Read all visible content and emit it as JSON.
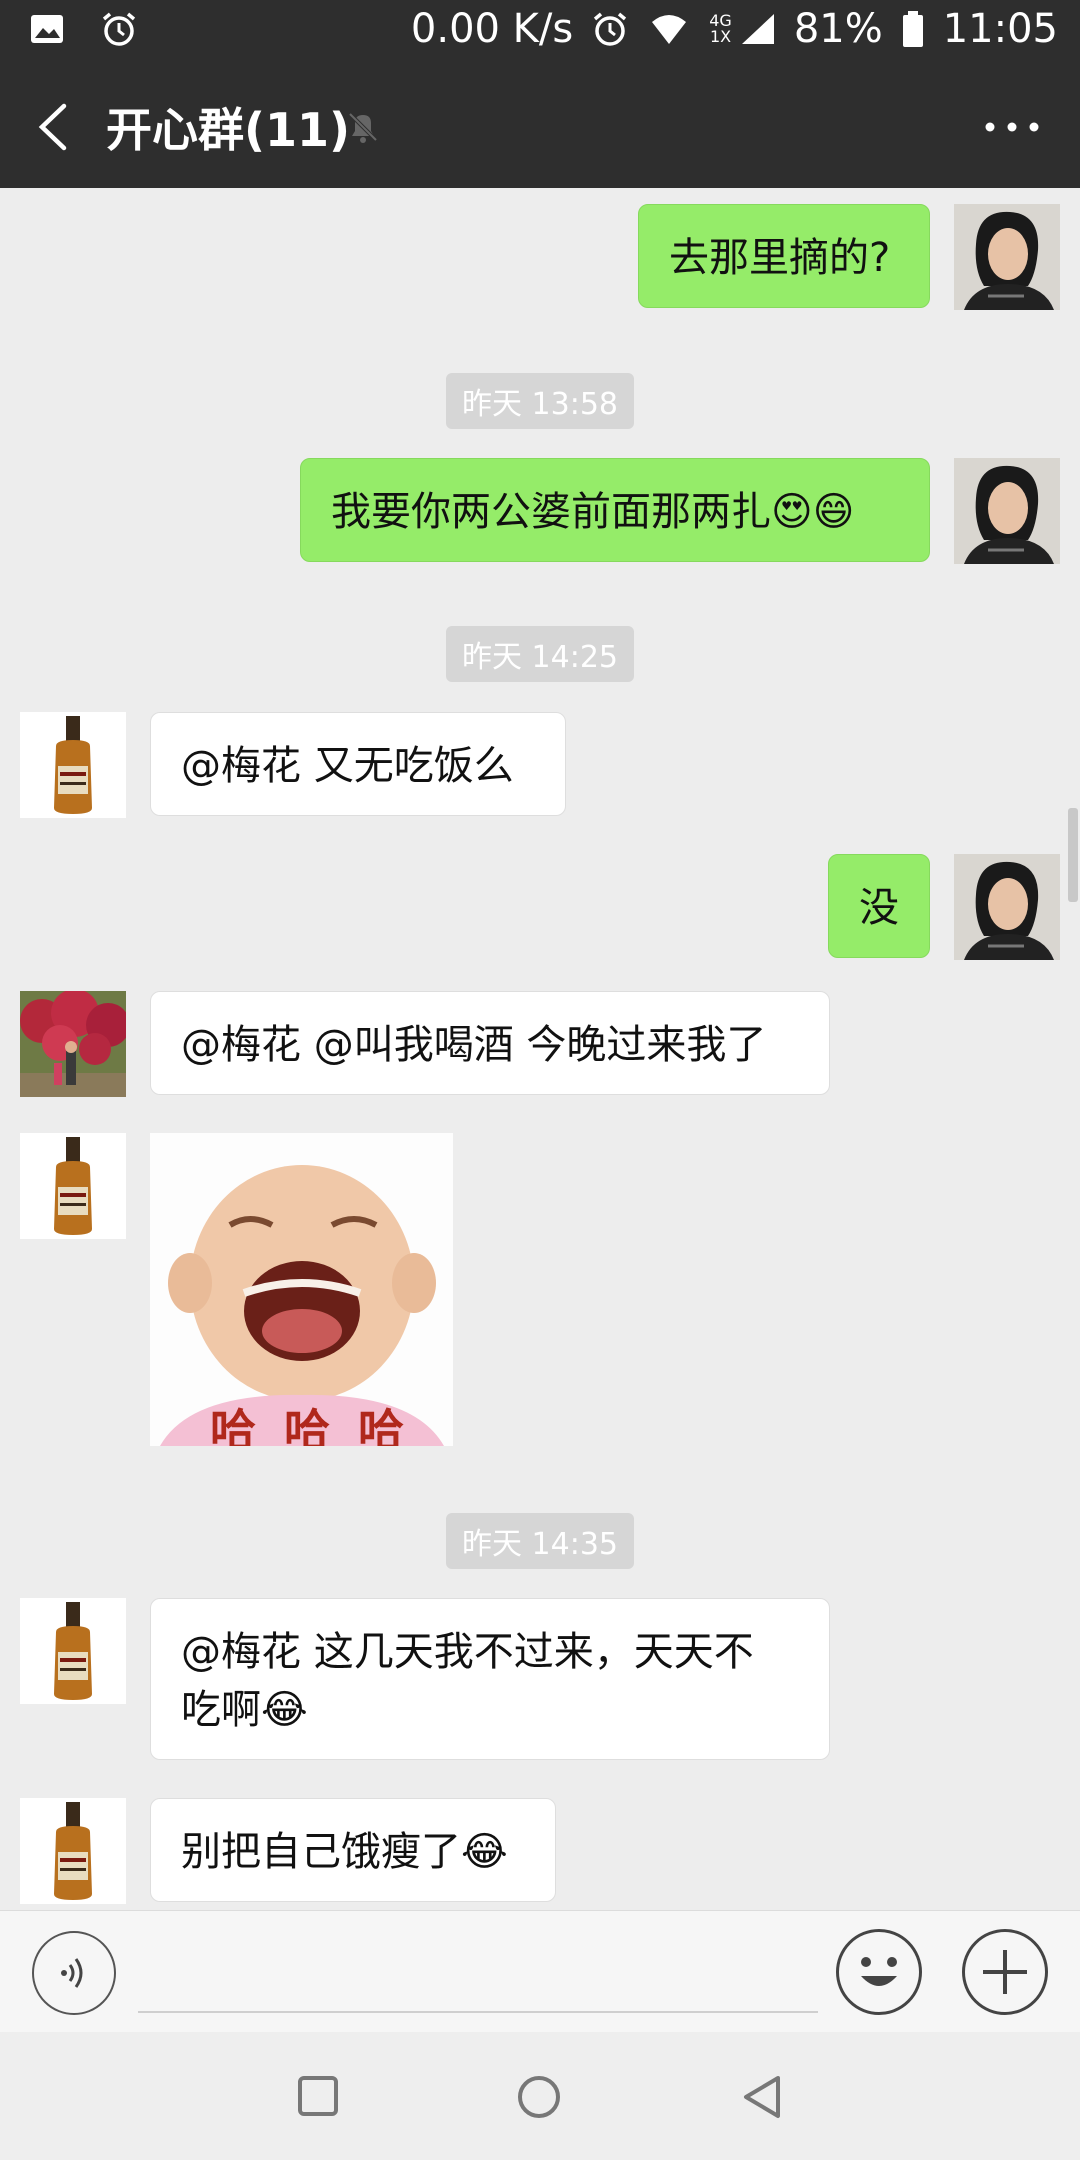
{
  "status_bar": {
    "speed": "0.00 K/s",
    "network_top": "4G",
    "network_bottom": "1X",
    "battery": "81%",
    "time": "11:05",
    "icons": [
      "image-icon",
      "alarm-icon",
      "alarm-icon",
      "wifi-icon",
      "signal-icon",
      "battery-icon"
    ]
  },
  "header": {
    "title": "开心群(11)",
    "icons": [
      "back-icon",
      "mute-bell-icon",
      "more-icon"
    ]
  },
  "messages": [
    {
      "side": "right",
      "text": "去那里摘的?"
    },
    {
      "type": "time",
      "text": "昨天 13:58"
    },
    {
      "side": "right",
      "text": "我要你两公婆前面那两扎😍😄"
    },
    {
      "type": "time",
      "text": "昨天 14:25"
    },
    {
      "side": "left",
      "avatar": "whisky-bottle",
      "text": "@梅花  又无吃饭么"
    },
    {
      "side": "right",
      "text": "没"
    },
    {
      "side": "left",
      "avatar": "flowers-photo",
      "text": "@梅花  @叫我喝酒  今晚过来我了"
    },
    {
      "side": "left",
      "avatar": "whisky-bottle",
      "type": "sticker",
      "sticker_text": "哈 哈 哈"
    },
    {
      "type": "time",
      "text": "昨天 14:35"
    },
    {
      "side": "left",
      "avatar": "whisky-bottle",
      "text_line1": "@梅花  这几天我不过来，天天不",
      "text_line2": "吃啊😂"
    },
    {
      "side": "left",
      "avatar": "whisky-bottle",
      "text": "别把自己饿瘦了😂"
    }
  ],
  "input_bar": {
    "icons": [
      "voice-icon",
      "emoji-icon",
      "add-icon"
    ]
  },
  "nav_bar": {
    "icons": [
      "recents-icon",
      "home-icon",
      "back-nav-icon"
    ]
  },
  "colors": {
    "bar": "#2e2e2e",
    "my_bubble": "#95ec69",
    "their_bubble": "#ffffff",
    "chat_bg": "#ededed"
  }
}
